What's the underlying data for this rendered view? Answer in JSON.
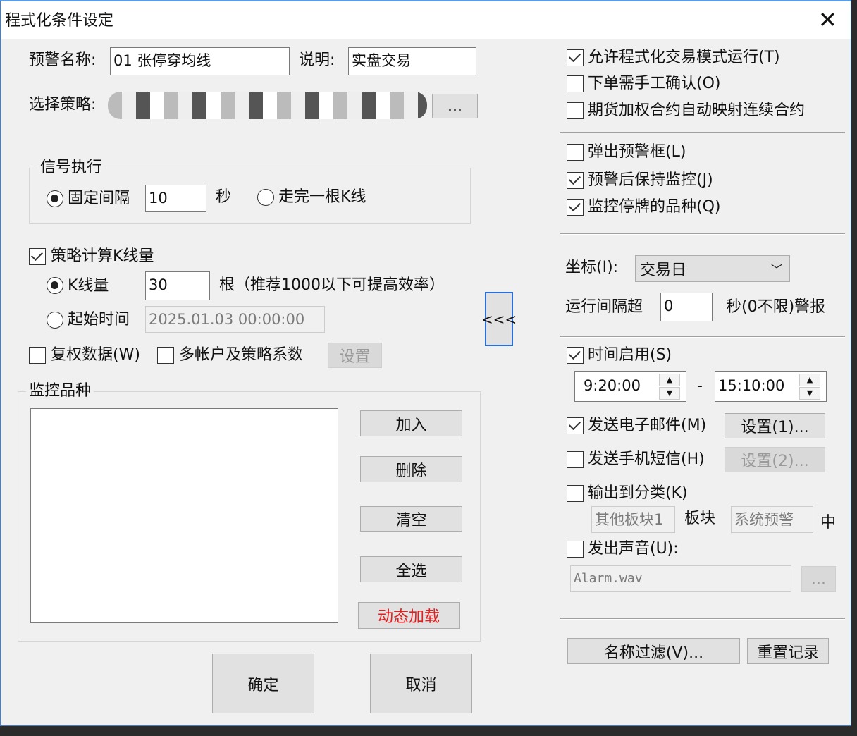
{
  "title": "程式化条件设定",
  "close_icon": "close-icon",
  "left": {
    "alert_name_label": "预警名称:",
    "alert_name_value": "01 张停穿均线",
    "desc_label": "说明:",
    "desc_value": "实盘交易",
    "strategy_label": "选择策略:",
    "strategy_browse": "...",
    "signal_group": "信号执行",
    "fixed_interval": "固定间隔",
    "interval_value": "10",
    "seconds": "秒",
    "bar_complete": "走完一根K线",
    "calc_bars": "策略计算K线量",
    "bars_label": "K线量",
    "bars_value": "30",
    "bars_hint": "根（推荐1000以下可提高效率）",
    "start_time_label": "起始时间",
    "start_time_value": "2025.01.03 00:00:00",
    "adjust": "复权数据(W)",
    "multi_account": "多帐户及策略系数",
    "settings": "设置",
    "monitor_group": "监控品种",
    "buttons": {
      "add": "加入",
      "delete": "删除",
      "clear": "清空",
      "select_all": "全选",
      "dynamic_load": "动态加载"
    },
    "collapse": "<<<",
    "ok": "确定",
    "cancel": "取消",
    "dynamic_color": "#e02020"
  },
  "right": {
    "allow_run": "允许程式化交易模式运行(T)",
    "manual_confirm": "下单需手工确认(O)",
    "futures_map": "期货加权合约自动映射连续合约",
    "popup": "弹出预警框(L)",
    "keep_monitor": "预警后保持监控(J)",
    "monitor_suspended": "监控停牌的品种(Q)",
    "axis_label": "坐标(I):",
    "axis_value": "交易日",
    "run_interval_label": "运行间隔超",
    "run_interval_value": "0",
    "run_interval_suffix": "秒(0不限)警报",
    "time_enable": "时间启用(S)",
    "time_start": "9:20:00",
    "time_dash": "-",
    "time_end": "15:10:00",
    "email": "发送电子邮件(M)",
    "email_settings": "设置(1)...",
    "sms": "发送手机短信(H)",
    "sms_settings": "设置(2)...",
    "output_category": "输出到分类(K)",
    "category_value": "其他板块1",
    "block": "板块",
    "block_value": "系统预警",
    "middle": "中",
    "sound": "发出声音(U):",
    "sound_file": "Alarm.wav",
    "sound_browse": "...",
    "name_filter": "名称过滤(V)...",
    "reset": "重置记录"
  }
}
